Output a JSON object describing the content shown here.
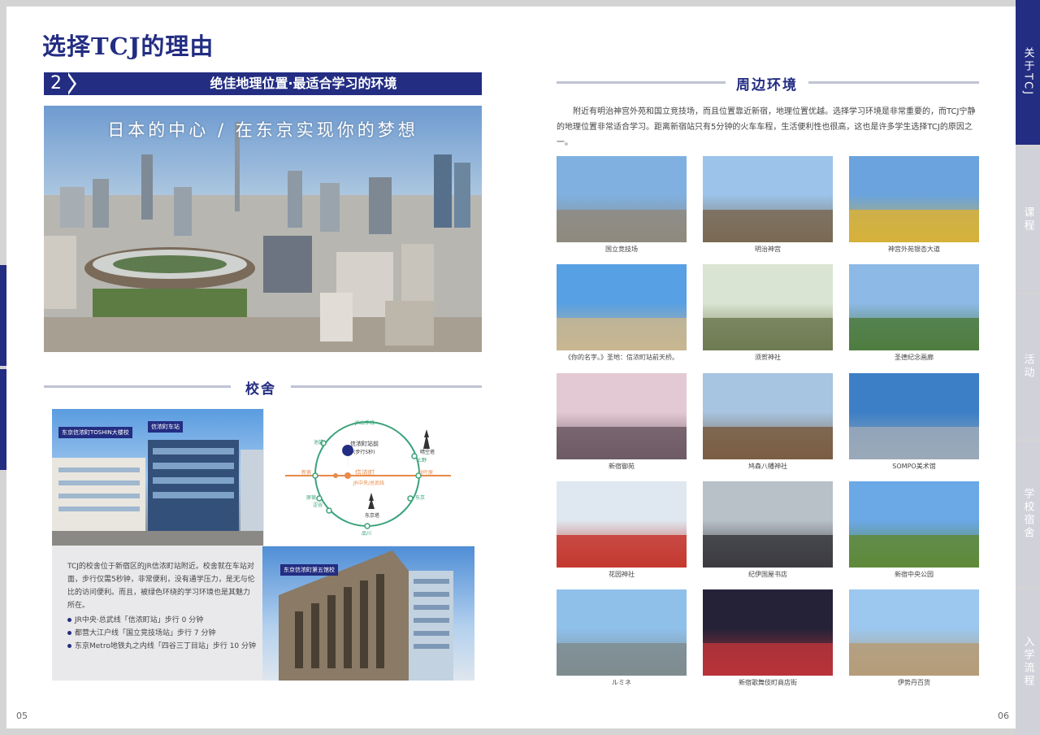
{
  "spread_title": "选择TCJ的理由",
  "section": {
    "number": "2",
    "title": "绝佳地理位置·最适合学习的环境"
  },
  "hero_caption": "日本的中心 / 在东京实现你的梦想",
  "campus": {
    "heading": "校舍",
    "labels": {
      "building1": "东京信浓町TOSHIN大楼校",
      "station": "信浓町车站",
      "building2": "东京信浓町第五馆校"
    },
    "map": {
      "yamanote": "JR山手线",
      "ikebukuro": "池袋",
      "shinanomachi_info": "信浓町站前",
      "walk": "(步行5秒)",
      "shinanomachi": "信浓町",
      "skytree": "晴空塔",
      "ueno": "上野",
      "akihabara": "秋叶原",
      "shinjuku": "新宿",
      "chuo_line": "JR中央/总武线",
      "harajuku": "原宿",
      "shibuya": "涩谷",
      "tokyo": "东京",
      "tower": "东京塔",
      "shinagawa": "品川"
    },
    "description": "TCJ的校舍位于新宿区的JR信浓町站附近。校舍就在车站对面，步行仅需5秒钟，非常便利，没有通学压力，是无与伦比的访问便利。而且，被绿色环绕的学习环境也是其魅力所在。",
    "access": [
      "JR中央·总武线「信浓町站」步行 0 分钟",
      "都营大江户线「国立竞技场站」步行 7 分钟",
      "东京Metro地铁丸之内线「四谷三丁目站」步行 10 分钟"
    ]
  },
  "environment": {
    "heading": "周边环境",
    "text": "附近有明治神宫外苑和国立竞技场，而且位置靠近新宿，地理位置优越。选择学习环境是非常重要的，而TCJ宁静的地理位置非常适合学习。距离新宿站只有5分钟的火车车程，生活便利性也很高，这也是许多学生选择TCJ的原因之一。",
    "photos": [
      {
        "caption": "国立竞技场",
        "sky": "#7fb0e0",
        "ground": "#8f8a7e"
      },
      {
        "caption": "明治神宫",
        "sky": "#9cc3ea",
        "ground": "#7a6a54"
      },
      {
        "caption": "神宫外苑银杏大道",
        "sky": "#6aa3dd",
        "ground": "#d7b13a"
      },
      {
        "caption": "《你的名字。》圣地：信浓町站前天桥。",
        "sky": "#58a0e4",
        "ground": "#c8b68f"
      },
      {
        "caption": "须贺神社",
        "sky": "#d9e4d2",
        "ground": "#6f7b52"
      },
      {
        "caption": "圣德纪念画廊",
        "sky": "#8db9e6",
        "ground": "#4f7d3f"
      },
      {
        "caption": "新宿御苑",
        "sky": "#e3c9d3",
        "ground": "#6d5a64"
      },
      {
        "caption": "鸠森八幡神社",
        "sky": "#a7c4e0",
        "ground": "#7a5d42"
      },
      {
        "caption": "SOMPO美术馆",
        "sky": "#3d7fc6",
        "ground": "#9aa9b8"
      },
      {
        "caption": "花园神社",
        "sky": "#dfe8f0",
        "ground": "#c4382f"
      },
      {
        "caption": "纪伊国屋书店",
        "sky": "#b8c0c8",
        "ground": "#3b3b40"
      },
      {
        "caption": "新宿中央公园",
        "sky": "#6aa8e6",
        "ground": "#5f8a3a"
      },
      {
        "caption": "ルミネ",
        "sky": "#8fc0ea",
        "ground": "#7f8c8f"
      },
      {
        "caption": "新宿歌舞伎町商店街",
        "sky": "#252238",
        "ground": "#b8343a"
      },
      {
        "caption": "伊势丹百货",
        "sky": "#9cc7ee",
        "ground": "#b59c78"
      }
    ]
  },
  "page_numbers": {
    "left": "05",
    "right": "06"
  },
  "side_tabs": [
    "关于TCJ",
    "课程",
    "活动",
    "学校宿舍",
    "入学流程"
  ],
  "colors": {
    "navy": "#232d82",
    "tab_inactive": "#d0d1d9"
  }
}
